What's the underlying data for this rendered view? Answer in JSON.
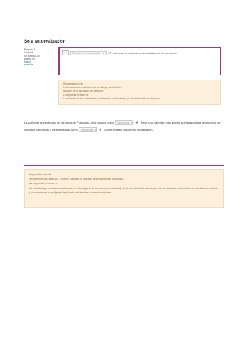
{
  "page": {
    "title": "Sera autoevaluación"
  },
  "question1": {
    "info_lines": [
      "Pregunta 1",
      "Correcta",
      "Se puntúa 1,00",
      "sobre 1,00",
      "Marcar",
      "pregunta"
    ],
    "select_value": "Respuesta seleccionada",
    "text": "puede ser el concepto de la asociación de los elementos",
    "feedback": {
      "heading": "Respuesta correcta",
      "lines": [
        "Los fundamentos de la diferencia constituyen la definición.",
        "Nociones de la asociación de elementos.",
        "La respuesta correcta es:",
        "La formación de las modalidades, los elementos que la definen y la asociación de sus elementos."
      ]
    }
  },
  "question2": {
    "text_a": "La variedad que estudian los alumnos de Psicología se la conoce como",
    "select_a": "Seleccione",
    "text_b": "Sería una variedad más amplia que la asociada, reconocida por los datos científicos y características como",
    "select_b": "Seleccione",
    "text_c": "donde existen dos o más modalidades.",
    "feedback": {
      "heading": "Respuesta correcta",
      "lines": [
        "Ver definición de intuición, el centro, también el glosario de conceptos de psicología.",
        "La respuesta correcta es:",
        "La variedad que estudian los alumnos en Psicología se la conoce como [intuición] Sería una variedad más amplia que la asociada, reconocida por los datos científicos y características como [paralelas] donde existen dos o más modalidades."
      ]
    }
  },
  "colors": {
    "accent": "#a03a7a",
    "feedback_bg": "#fcf0dc",
    "correct": "#3a8a2e"
  }
}
